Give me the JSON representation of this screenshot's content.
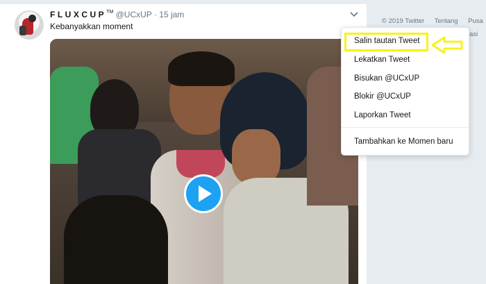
{
  "tweet": {
    "author_name": "FLUXCUP",
    "author_tm": "TM",
    "handle": "@UCxUP",
    "separator": "·",
    "time": "15 jam",
    "text": "Kebanyakkan moment"
  },
  "media": {
    "type": "video",
    "play_icon": "play-icon"
  },
  "sidebar_footer": {
    "copyright": "© 2019 Twitter",
    "links": [
      "Tentang",
      "Pusa"
    ],
    "line2": "asi"
  },
  "dropdown_menu": {
    "items": [
      "Salin tautan Tweet",
      "Lekatkan Tweet",
      "Bisukan @UCxUP",
      "Blokir @UCxUP",
      "Laporkan Tweet",
      "Tambahkan ke Momen baru"
    ],
    "highlighted_index": 0
  },
  "annotation": {
    "box_color": "#f7f31b",
    "arrow_color": "#f7f31b"
  },
  "colors": {
    "accent": "#1da1f2",
    "secondary_text": "#657786",
    "background": "#e6ecf0"
  }
}
